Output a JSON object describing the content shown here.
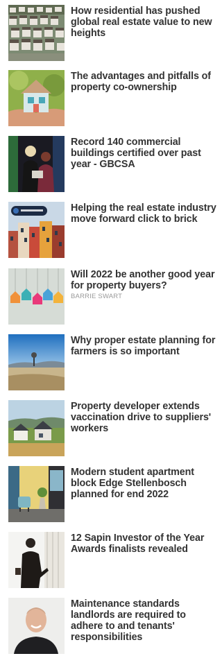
{
  "articles": [
    {
      "title": "How residential has pushed global real estate value to new heights",
      "thumb_icon": "suburban-houses-aerial-thumbnail"
    },
    {
      "title": "The advantages and pitfalls of property co-ownership",
      "thumb_icon": "toy-house-in-hands-thumbnail"
    },
    {
      "title": "Record 140 commercial buildings certified over past year - GBCSA",
      "thumb_icon": "award-ceremony-women-thumbnail"
    },
    {
      "title": "Helping the real estate industry move forward click to brick",
      "thumb_icon": "colorful-townhouses-thumbnail"
    },
    {
      "title": "Will 2022 be another good year for property buyers?",
      "byline": "BARRIE SWART",
      "thumb_icon": "hanging-paper-houses-thumbnail"
    },
    {
      "title": "Why proper estate planning for farmers is so important",
      "thumb_icon": "farmland-landscape-thumbnail"
    },
    {
      "title": "Property developer extends vaccination drive to suppliers' workers",
      "thumb_icon": "housing-development-thumbnail"
    },
    {
      "title": "Modern student apartment block Edge Stellenbosch planned for end 2022",
      "thumb_icon": "apartment-interior-thumbnail"
    },
    {
      "title": "12 Sapin Investor of the Year Awards finalists revealed",
      "thumb_icon": "businessman-silhouette-thumbnail"
    },
    {
      "title": "Maintenance standards landlords are required to adhere to and tenants' responsibilities",
      "thumb_icon": "smiling-man-portrait-thumbnail"
    }
  ]
}
